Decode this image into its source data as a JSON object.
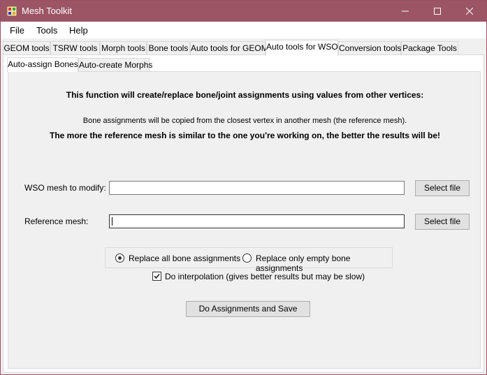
{
  "window": {
    "title": "Mesh Toolkit",
    "title_bar_color": "#9b5565"
  },
  "menu": [
    "File",
    "Tools",
    "Help"
  ],
  "tabs": [
    "GEOM tools",
    "TSRW tools",
    "Morph tools",
    "Bone tools",
    "Auto tools for GEOM",
    "Auto tools for WSO",
    "Conversion tools",
    "Package Tools"
  ],
  "active_tab": "Auto tools for WSO",
  "subtabs": [
    "Auto-assign Bones",
    "Auto-create Morphs"
  ],
  "active_subtab": "Auto-assign Bones",
  "content": {
    "heading": "This function will create/replace bone/joint assignments using values from other vertices:",
    "description": "Bone assignments will be copied from the closest vertex in another mesh (the reference mesh).",
    "note": "The more the reference mesh is similar to the one you're working on, the better the results will be!",
    "wso_label": "WSO mesh to modify:",
    "wso_value": "",
    "reference_label": "Reference mesh:",
    "reference_value": "",
    "select_file_label": "Select file",
    "radio_replace_all": "Replace all bone assignments",
    "radio_replace_empty": "Replace only empty bone assignments",
    "radio_selected": "Replace all bone assignments",
    "interpolation_label": "Do interpolation (gives better results but may be slow)",
    "interpolation_checked": true,
    "action_button": "Do Assignments and Save"
  }
}
